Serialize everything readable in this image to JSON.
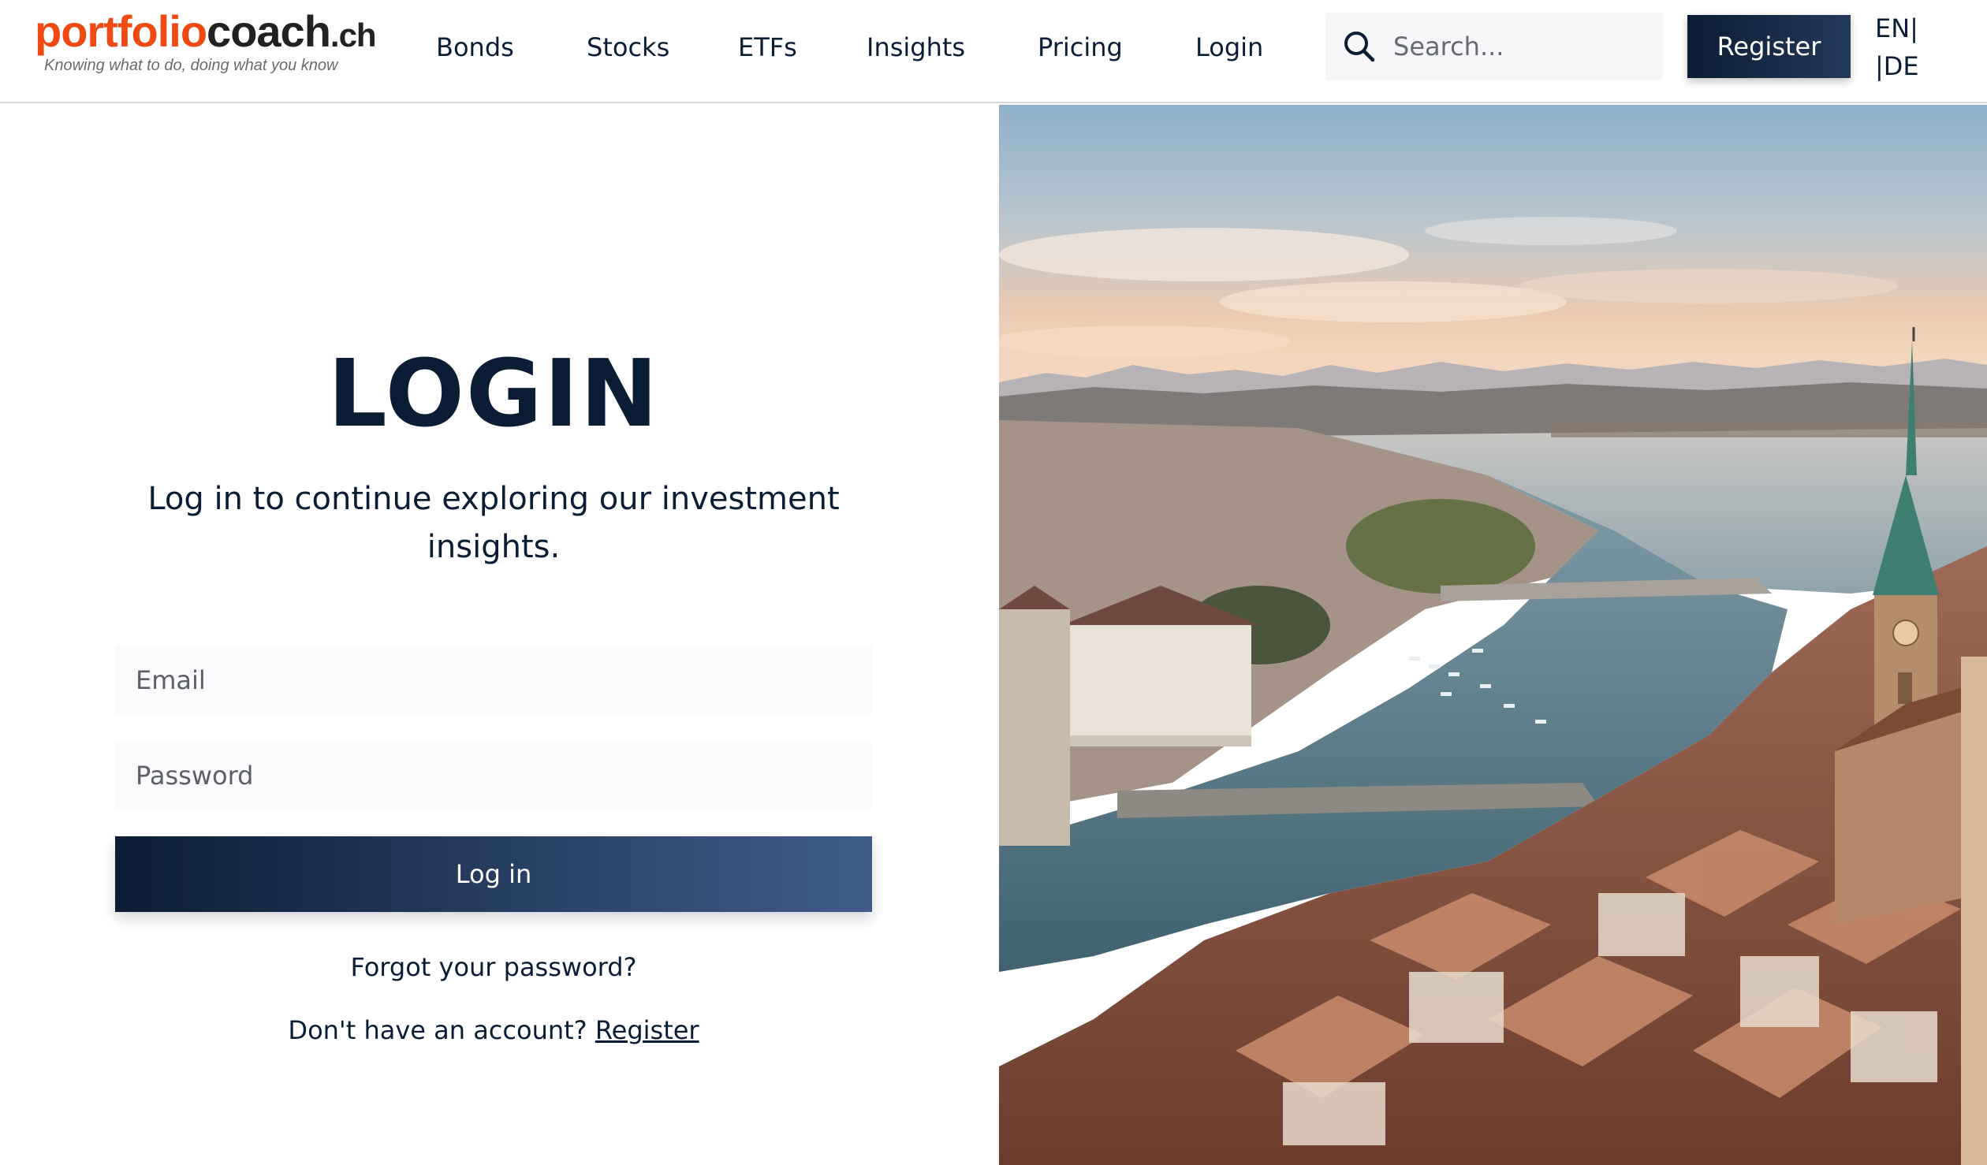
{
  "brand": {
    "name_part1": "portfolio",
    "name_part2": "coach",
    "tld": ".ch",
    "tagline": "Knowing what to do, doing what you know",
    "accent_color": "#f04a14",
    "primary_color": "#0b1d35"
  },
  "nav": {
    "items": [
      {
        "label": "Bonds"
      },
      {
        "label": "Stocks"
      },
      {
        "label": "ETFs"
      },
      {
        "label": "Insights"
      },
      {
        "label": "Pricing"
      },
      {
        "label": "Login"
      }
    ]
  },
  "search": {
    "placeholder": "Search...",
    "icon": "search-icon"
  },
  "header": {
    "register_label": "Register",
    "lang_en": "EN|",
    "lang_de": "|DE"
  },
  "login": {
    "title": "LOGIN",
    "subtitle": "Log in to continue exploring our investment insights.",
    "email_placeholder": "Email",
    "password_placeholder": "Password",
    "submit_label": "Log in",
    "forgot_label": "Forgot your password?",
    "no_account_text": "Don't have an account? ",
    "register_link_label": "Register"
  },
  "hero_image": {
    "alt": "Aerial view of Zurich with the Limmat river, lake and Alps"
  }
}
